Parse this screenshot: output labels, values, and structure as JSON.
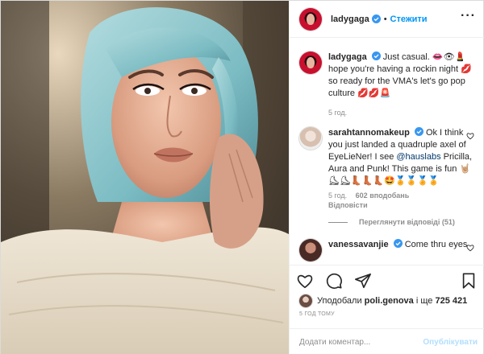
{
  "header": {
    "username": "ladygaga",
    "separator": "•",
    "follow_label": "Стежити",
    "more_label": "···"
  },
  "caption": {
    "username": "ladygaga",
    "text": "Just casual. 👄👁💄hope you're having a rockin night 💋 so ready for the VMA's let's go pop culture 💋💋🚨",
    "time": "5 год."
  },
  "comments": [
    {
      "username": "sarahtannomakeup",
      "text_before": "Ok I think you just landed a quadruple axel of EyeLieNer! I see ",
      "mention": "@hauslabs",
      "text_after": " Pricilla, Aura and Punk! This game is fun 🤘🏼⛸⛸👢👢👢🤩🏅🏅🏅🏅",
      "time": "5 год.",
      "likes": "602 вподобань",
      "reply_label": "Відповісти",
      "view_replies": "Переглянути відповіді (51)"
    },
    {
      "username": "vanessavanjie",
      "text": "Come thru eyes"
    }
  ],
  "likes": {
    "prefix": "Уподобали ",
    "user": "poli.genova",
    "middle": " і ще ",
    "count": "725 421"
  },
  "timestamp": "5 ГОД ТОМУ",
  "add_comment": {
    "placeholder": "Додати коментар...",
    "publish_label": "Опублікувати"
  },
  "colors": {
    "accent": "#0095f6",
    "verified": "#3897f0",
    "muted": "#8e8e8e"
  }
}
